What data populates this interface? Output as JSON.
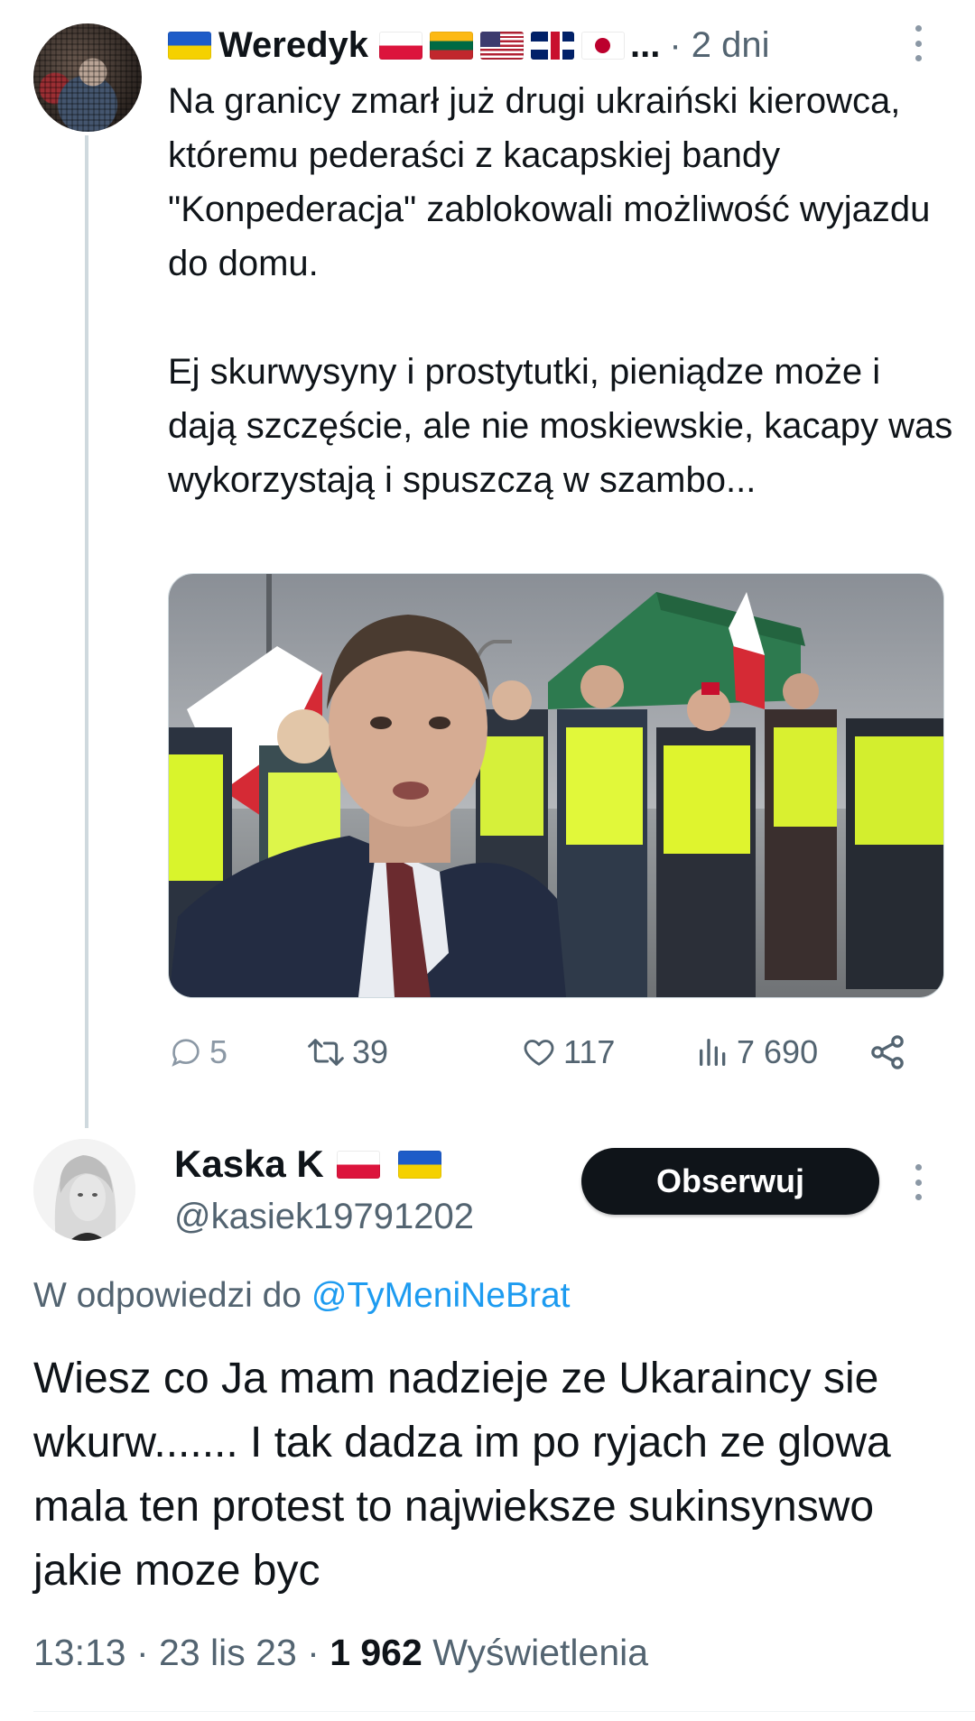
{
  "parent_tweet": {
    "author_name": "Weredyk",
    "name_flags": [
      "flag-ukraine",
      "flag-poland",
      "flag-lithuania",
      "flag-usa",
      "flag-uk",
      "flag-japan"
    ],
    "name_truncation": "...",
    "time": "· 2 dni",
    "paragraph1": "Na granicy zmarł już drugi ukraiński kierowca, któremu pederaści z kacapskiej bandy \"Konpederacja\" zablokowali możliwość wyjazdu do domu.",
    "paragraph2": "Ej skurwysyny i prostytutki, pieniądze może i dają szczęście, ale nie moskiewskie, kacapy was wykorzystają i spuszczą w szambo...",
    "stats": {
      "replies": "5",
      "retweets": "39",
      "likes": "117",
      "views": "7 690"
    }
  },
  "reply_tweet": {
    "author_name": "Kaska K",
    "name_flags": [
      "flag-poland",
      "flag-ukraine"
    ],
    "handle": "@kasiek19791202",
    "follow_label": "Obserwuj",
    "replying_prefix": "W odpowiedzi do",
    "replying_mention": "@TyMeniNeBrat",
    "text": "Wiesz co Ja mam nadzieje ze Ukaraincy sie wkurw....... I tak dadza im po ryjach ze glowa mala ten protest to najwieksze sukinsynswo jakie moze byc",
    "time": "13:13 · 23 lis 23 · ",
    "views_count": "1 962",
    "views_label": " Wyświetlenia"
  },
  "colors": {
    "text": "#0f1419",
    "secondary": "#536471",
    "link": "#1d9bf0",
    "button_bg": "#0f1419",
    "thread_line": "#cfd9de"
  }
}
